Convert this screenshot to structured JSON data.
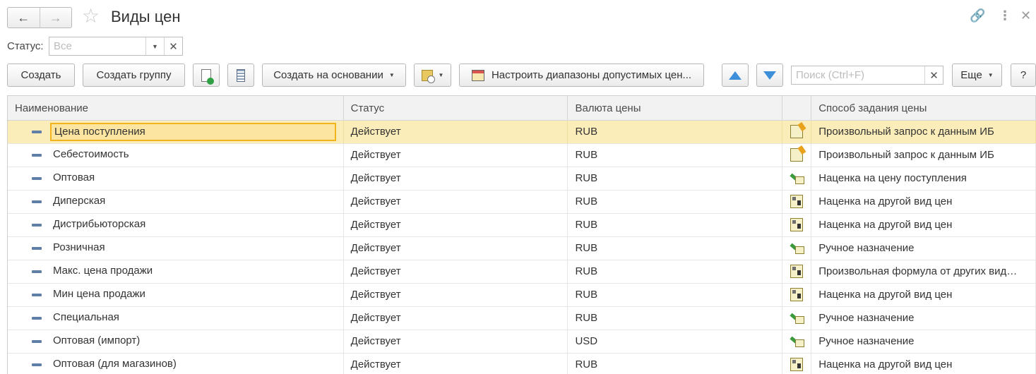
{
  "header": {
    "title": "Виды цен",
    "back_icon": "arrow-left-icon",
    "forward_icon": "arrow-right-icon",
    "favorite_icon": "star-icon"
  },
  "filter": {
    "status_label": "Статус:",
    "status_placeholder": "Все"
  },
  "toolbar": {
    "create": "Создать",
    "create_group": "Создать группу",
    "create_based_on": "Создать на основании",
    "configure_ranges": "Настроить диапазоны допустимых цен...",
    "search_placeholder": "Поиск (Ctrl+F)",
    "more": "Еще",
    "help": "?"
  },
  "table": {
    "columns": [
      "Наименование",
      "Статус",
      "Валюта цены",
      "",
      "Способ задания цены"
    ],
    "rows": [
      {
        "name": "Цена поступления",
        "status": "Действует",
        "currency": "RUB",
        "method_icon": "query",
        "method": "Произвольный запрос к данным ИБ"
      },
      {
        "name": "Себестоимость",
        "status": "Действует",
        "currency": "RUB",
        "method_icon": "query",
        "method": "Произвольный запрос к данным ИБ"
      },
      {
        "name": "Оптовая",
        "status": "Действует",
        "currency": "RUB",
        "method_icon": "manual",
        "method": "Наценка на цену поступления"
      },
      {
        "name": "Диперская",
        "status": "Действует",
        "currency": "RUB",
        "method_icon": "markup",
        "method": "Наценка на другой вид цен"
      },
      {
        "name": "Дистрибьюторская",
        "status": "Действует",
        "currency": "RUB",
        "method_icon": "markup",
        "method": "Наценка на другой вид цен"
      },
      {
        "name": "Розничная",
        "status": "Действует",
        "currency": "RUB",
        "method_icon": "manual",
        "method": "Ручное назначение"
      },
      {
        "name": "Макс. цена продажи",
        "status": "Действует",
        "currency": "RUB",
        "method_icon": "markup",
        "method": "Произвольная формула от других вид…"
      },
      {
        "name": "Мин цена продажи",
        "status": "Действует",
        "currency": "RUB",
        "method_icon": "markup",
        "method": "Наценка на другой вид цен"
      },
      {
        "name": "Специальная",
        "status": "Действует",
        "currency": "RUB",
        "method_icon": "manual",
        "method": "Ручное назначение"
      },
      {
        "name": "Оптовая (импорт)",
        "status": "Действует",
        "currency": "USD",
        "method_icon": "manual",
        "method": "Ручное назначение"
      },
      {
        "name": "Оптовая (для магазинов)",
        "status": "Действует",
        "currency": "RUB",
        "method_icon": "markup",
        "method": "Наценка на другой вид цен"
      }
    ]
  }
}
